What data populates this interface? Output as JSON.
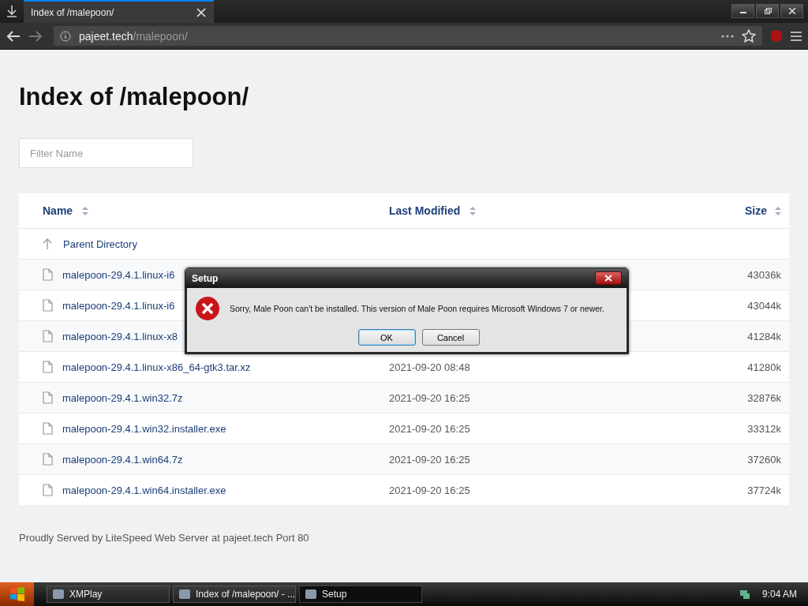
{
  "browser": {
    "tab_title": "Index of /malepoon/",
    "url_host": "pajeet.tech",
    "url_path": "/malepoon/"
  },
  "page": {
    "heading": "Index of /malepoon/",
    "filter": {
      "placeholder": "Filter Name"
    },
    "columns": [
      "Name",
      "Last Modified",
      "Size"
    ],
    "rows": [
      {
        "kind": "parent",
        "name": "Parent Directory",
        "modified": "",
        "size": ""
      },
      {
        "kind": "file",
        "name": "malepoon-29.4.1.linux-i6",
        "modified": "",
        "size": "43036k"
      },
      {
        "kind": "file",
        "name": "malepoon-29.4.1.linux-i6",
        "modified": "",
        "size": "43044k"
      },
      {
        "kind": "file",
        "name": "malepoon-29.4.1.linux-x8",
        "modified": "",
        "size": "41284k"
      },
      {
        "kind": "file",
        "name": "malepoon-29.4.1.linux-x86_64-gtk3.tar.xz",
        "modified": "2021-09-20 08:48",
        "size": "41280k"
      },
      {
        "kind": "file",
        "name": "malepoon-29.4.1.win32.7z",
        "modified": "2021-09-20 16:25",
        "size": "32876k"
      },
      {
        "kind": "file",
        "name": "malepoon-29.4.1.win32.installer.exe",
        "modified": "2021-09-20 16:25",
        "size": "33312k"
      },
      {
        "kind": "file",
        "name": "malepoon-29.4.1.win64.7z",
        "modified": "2021-09-20 16:25",
        "size": "37260k"
      },
      {
        "kind": "file",
        "name": "malepoon-29.4.1.win64.installer.exe",
        "modified": "2021-09-20 16:25",
        "size": "37724k"
      }
    ],
    "footer": "Proudly Served by LiteSpeed Web Server at pajeet.tech Port 80"
  },
  "dialog": {
    "title": "Setup",
    "message": "Sorry, Male Poon can't be installed. This version of Male Poon requires Microsoft Windows 7 or newer.",
    "buttons": [
      {
        "label": "OK",
        "selected": true
      },
      {
        "label": "Cancel",
        "selected": false
      }
    ]
  },
  "taskbar": {
    "items": [
      {
        "label": "XMPlay",
        "selected": false
      },
      {
        "label": "Index of /malepoon/ - ...",
        "selected": false
      },
      {
        "label": "Setup",
        "selected": true
      }
    ],
    "time": "9:04 AM"
  }
}
